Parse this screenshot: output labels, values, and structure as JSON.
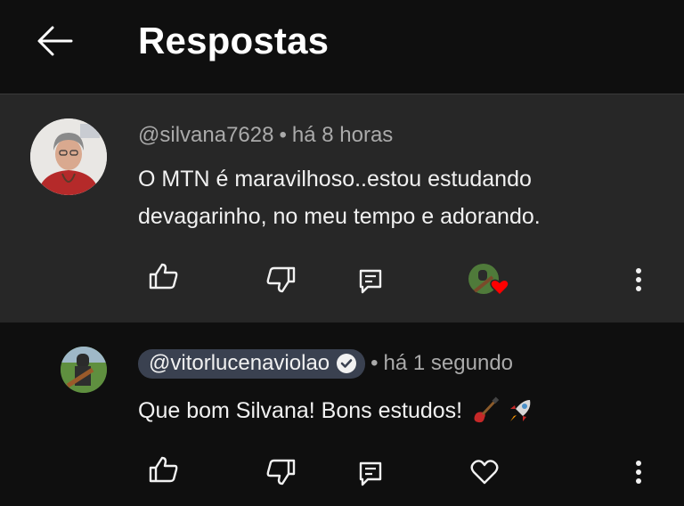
{
  "header": {
    "title": "Respostas",
    "back_icon": "arrow-left-icon"
  },
  "comment": {
    "author": "@silvana7628",
    "separator": "•",
    "time": "há 8 horas",
    "text_line1": "O MTN é maravilhoso..estou estudando",
    "text_line2": "devagarinho, no meu tempo e adorando.",
    "actions": [
      "thumb-up-icon",
      "thumb-down-icon",
      "reply-icon",
      "creator-heart-icon",
      "more-vert-icon"
    ]
  },
  "reply": {
    "author": "@vitorlucenaviolao",
    "separator": "•",
    "time": "há 1 segundo",
    "text": "Que bom Silvana! Bons estudos!",
    "emojis": [
      "guitar-icon",
      "rocket-icon"
    ],
    "actions": [
      "thumb-up-icon",
      "thumb-down-icon",
      "reply-icon",
      "heart-outline-icon",
      "more-vert-icon"
    ]
  },
  "colors": {
    "background": "#0f0f0f",
    "highlight": "#272727",
    "secondary_text": "#aaaaaa",
    "chip": "#3a4150",
    "heart": "#ff0000"
  }
}
